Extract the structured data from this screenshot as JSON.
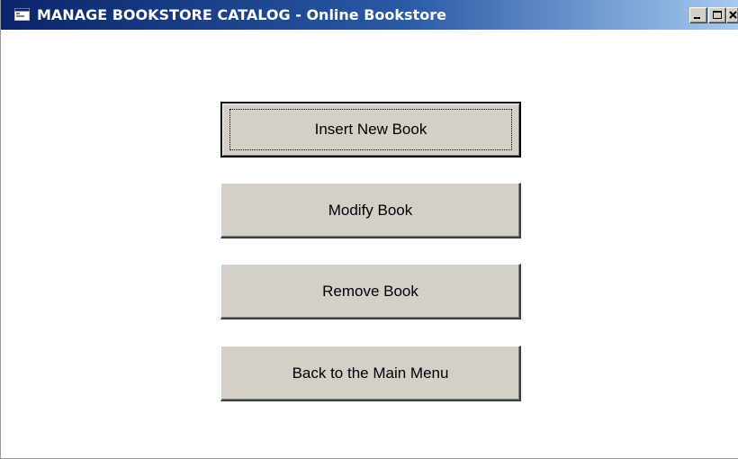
{
  "window": {
    "title": "MANAGE BOOKSTORE CATALOG - Online Bookstore",
    "icon": "window-app-icon",
    "title_bar_color": "#0a246a",
    "caption_buttons": [
      "minimize-icon",
      "maximize-icon",
      "close-icon"
    ]
  },
  "menu": {
    "buttons": [
      {
        "label": "Insert New Book",
        "focused": true
      },
      {
        "label": "Modify Book",
        "focused": false
      },
      {
        "label": "Remove Book",
        "focused": false
      },
      {
        "label": "Back to the Main Menu",
        "focused": false
      }
    ]
  },
  "colors": {
    "button_face": "#d4d0c8",
    "client_background": "#ffffff"
  }
}
